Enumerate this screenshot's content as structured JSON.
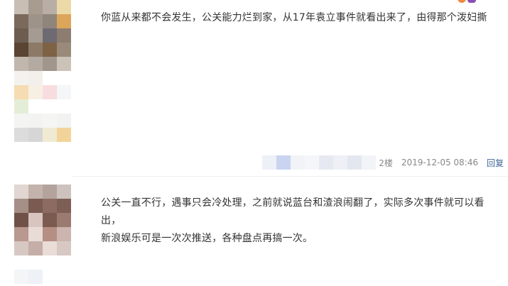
{
  "comments": [
    {
      "text": "你蓝从来都不会发生，公关能力烂到家，从17年袁立事件就看出来了，由得那个泼妇撕",
      "floor": "2楼",
      "time": "2019-12-05 08:46",
      "reply_label": "回复"
    },
    {
      "text_line1": "公关一直不行，遇事只会冷处理，之前就说蓝台和渣浪闹翻了，实际多次事件就可以看出，",
      "text_line2": "新浪娱乐可是一次次推送，各种盘点再搞一次。"
    }
  ],
  "colors": {
    "text": "#333333",
    "meta": "#999999",
    "reply_link": "#406599",
    "divider": "#eeeeee"
  },
  "icons": {
    "avatar_1": "pixelated-avatar",
    "avatar_2": "pixelated-avatar",
    "username_2": "pixelated-username"
  }
}
